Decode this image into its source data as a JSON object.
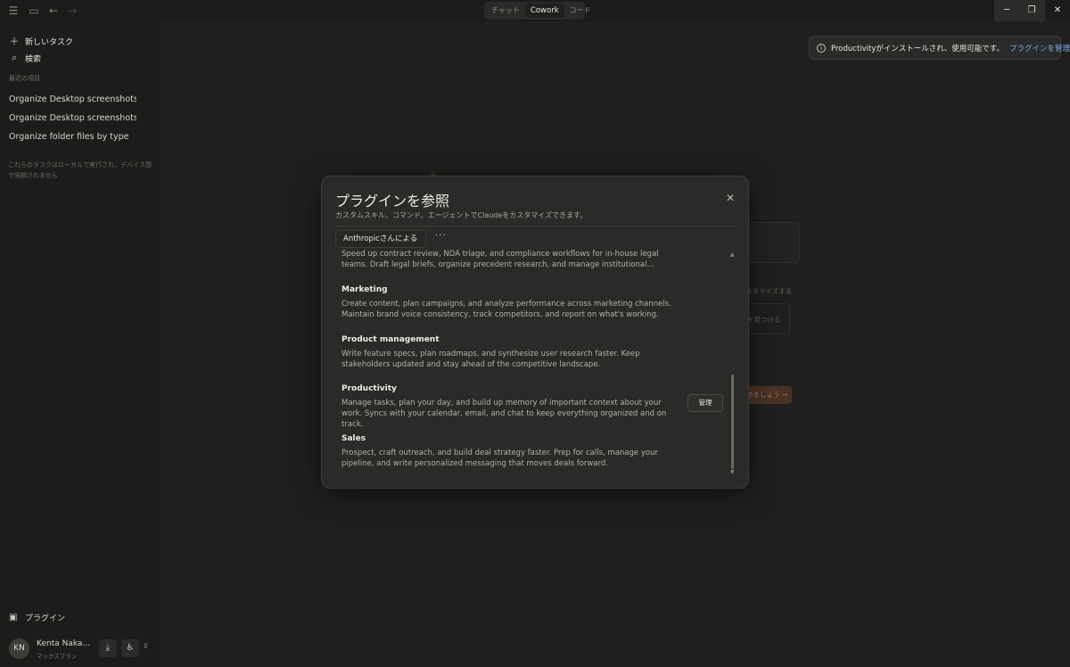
{
  "titlebar": {
    "tabs": [
      {
        "label": "チャット",
        "active": false
      },
      {
        "label": "Cowork",
        "active": true
      },
      {
        "label": "コード",
        "active": false
      }
    ]
  },
  "sidebar": {
    "new_task": "新しいタスク",
    "search": "検索",
    "recent_heading": "最近の項目",
    "recent_items": [
      "Organize Desktop screenshots and",
      "Organize Desktop screenshots and",
      "Organize folder files by type"
    ],
    "local_note": "これらのタスクはローカルで実行され、デバイス間で同期されません",
    "plugins_label": "プラグイン",
    "user": {
      "initials": "KN",
      "name": "Kenta Nakamura",
      "plan": "マックスプラン"
    }
  },
  "background": {
    "customize": "スタマイズする",
    "find": "を見つける",
    "start": "めましょう →"
  },
  "toast": {
    "message": "Productivityがインストールされ、使用可能です。",
    "link": "プラグインを管理"
  },
  "modal": {
    "title": "プラグインを参照",
    "subtitle": "カスタムスキル、コマンド、エージェントでClaudeをカスタマイズできます。",
    "filter_label": "Anthropicさんによる",
    "manage_label": "管理",
    "plugins": [
      {
        "name": "",
        "desc": "Speed up contract review, NDA triage, and compliance workflows for in-house legal teams. Draft legal briefs, organize precedent research, and manage institutional…"
      },
      {
        "name": "Marketing",
        "desc": "Create content, plan campaigns, and analyze performance across marketing channels. Maintain brand voice consistency, track competitors, and report on what's working."
      },
      {
        "name": "Product management",
        "desc": "Write feature specs, plan roadmaps, and synthesize user research faster. Keep stakeholders updated and stay ahead of the competitive landscape."
      },
      {
        "name": "Productivity",
        "desc": "Manage tasks, plan your day, and build up memory of important context about your work. Syncs with your calendar, email, and chat to keep everything organized and on track."
      },
      {
        "name": "Sales",
        "desc": "Prospect, craft outreach, and build deal strategy faster. Prep for calls, manage your pipeline, and write personalized messaging that moves deals forward."
      }
    ]
  }
}
